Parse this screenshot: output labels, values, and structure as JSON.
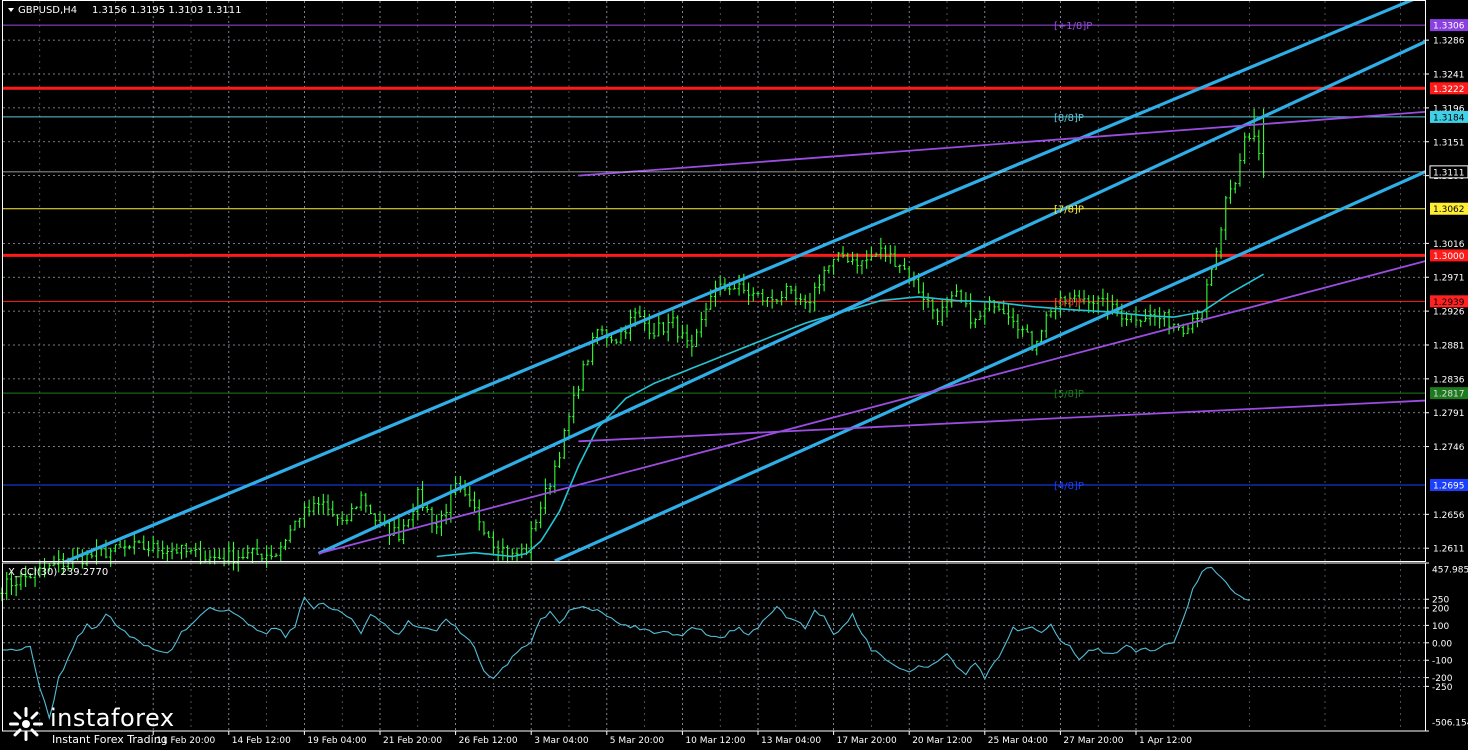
{
  "header": {
    "symbol": "GBPUSD,H4",
    "ohlc": "1.3156 1.3195 1.3103 1.3111",
    "indicator": "X_CCI(30) 239.2770"
  },
  "branding": {
    "name": "instaforex",
    "tagline": "Instant Forex Trading"
  },
  "colors": {
    "background": "#000000",
    "grid": "#9aa3b0",
    "candle": "#33ff33",
    "channel": "#2faee8",
    "ma": "#25c4d4",
    "violet": "#9b4de0",
    "red_level": "#ff1a1a",
    "cci_line": "#53bcd6",
    "axis_text": "#ffffff"
  },
  "chart_data": [
    {
      "type": "candlestick",
      "title": "GBPUSD,H4",
      "symbol": "GBPUSD",
      "timeframe": "H4",
      "ylim": [
        1.2594,
        1.3338
      ],
      "yticks": [
        1.3286,
        1.3241,
        1.3196,
        1.3151,
        1.3106,
        1.3016,
        1.2971,
        1.2926,
        1.2881,
        1.2836,
        1.2791,
        1.2746,
        1.2656,
        1.2611
      ],
      "xticks": [
        {
          "label": "11 Feb 20:00",
          "bar": 32
        },
        {
          "label": "14 Feb 12:00",
          "bar": 48
        },
        {
          "label": "19 Feb 04:00",
          "bar": 64
        },
        {
          "label": "21 Feb 20:00",
          "bar": 80
        },
        {
          "label": "26 Feb 12:00",
          "bar": 96
        },
        {
          "label": "3 Mar 04:00",
          "bar": 112
        },
        {
          "label": "5 Mar 20:00",
          "bar": 128
        },
        {
          "label": "10 Mar 12:00",
          "bar": 144
        },
        {
          "label": "13 Mar 04:00",
          "bar": 160
        },
        {
          "label": "17 Mar 20:00",
          "bar": 176
        },
        {
          "label": "20 Mar 12:00",
          "bar": 192
        },
        {
          "label": "25 Mar 04:00",
          "bar": 208
        },
        {
          "label": "27 Mar 20:00",
          "bar": 224
        },
        {
          "label": "1 Apr 12:00",
          "bar": 240
        }
      ],
      "bar_count": 270,
      "close_anchors": [
        [
          0,
          1.256
        ],
        [
          12,
          1.259
        ],
        [
          22,
          1.2606
        ],
        [
          28,
          1.2612
        ],
        [
          36,
          1.261
        ],
        [
          44,
          1.2598
        ],
        [
          52,
          1.2602
        ],
        [
          58,
          1.2604
        ],
        [
          63,
          1.2655
        ],
        [
          68,
          1.267
        ],
        [
          72,
          1.264
        ],
        [
          76,
          1.268
        ],
        [
          80,
          1.264
        ],
        [
          84,
          1.263
        ],
        [
          88,
          1.268
        ],
        [
          92,
          1.264
        ],
        [
          96,
          1.269
        ],
        [
          100,
          1.266
        ],
        [
          104,
          1.262
        ],
        [
          108,
          1.26
        ],
        [
          111,
          1.261
        ],
        [
          113,
          1.265
        ],
        [
          116,
          1.27
        ],
        [
          119,
          1.276
        ],
        [
          122,
          1.283
        ],
        [
          126,
          1.29
        ],
        [
          130,
          1.289
        ],
        [
          134,
          1.292
        ],
        [
          138,
          1.29
        ],
        [
          142,
          1.291
        ],
        [
          146,
          1.287
        ],
        [
          150,
          1.295
        ],
        [
          154,
          1.296
        ],
        [
          158,
          1.295
        ],
        [
          162,
          1.294
        ],
        [
          166,
          1.295
        ],
        [
          170,
          1.293
        ],
        [
          174,
          1.298
        ],
        [
          178,
          1.3
        ],
        [
          182,
          1.299
        ],
        [
          186,
          1.3005
        ],
        [
          190,
          1.299
        ],
        [
          194,
          1.2955
        ],
        [
          198,
          1.292
        ],
        [
          202,
          1.2945
        ],
        [
          206,
          1.291
        ],
        [
          210,
          1.294
        ],
        [
          214,
          1.292
        ],
        [
          218,
          1.288
        ],
        [
          222,
          1.293
        ],
        [
          226,
          1.294
        ],
        [
          230,
          1.2945
        ],
        [
          234,
          1.293
        ],
        [
          238,
          1.292
        ],
        [
          242,
          1.292
        ],
        [
          246,
          1.2915
        ],
        [
          250,
          1.2905
        ],
        [
          254,
          1.293
        ],
        [
          257,
          1.3
        ],
        [
          259,
          1.307
        ],
        [
          261,
          1.309
        ],
        [
          263,
          1.3156
        ],
        [
          265,
          1.316
        ],
        [
          267,
          1.3111
        ]
      ],
      "ma_anchors": [
        [
          92,
          1.26
        ],
        [
          100,
          1.2605
        ],
        [
          108,
          1.26
        ],
        [
          111,
          1.2604
        ],
        [
          114,
          1.262
        ],
        [
          118,
          1.266
        ],
        [
          122,
          1.272
        ],
        [
          126,
          1.277
        ],
        [
          132,
          1.281
        ],
        [
          138,
          1.283
        ],
        [
          146,
          1.285
        ],
        [
          154,
          1.287
        ],
        [
          162,
          1.289
        ],
        [
          170,
          1.291
        ],
        [
          178,
          1.2925
        ],
        [
          186,
          1.294
        ],
        [
          194,
          1.2945
        ],
        [
          202,
          1.294
        ],
        [
          210,
          1.2938
        ],
        [
          218,
          1.2932
        ],
        [
          226,
          1.2928
        ],
        [
          234,
          1.2925
        ],
        [
          242,
          1.292
        ],
        [
          248,
          1.2918
        ],
        [
          254,
          1.2925
        ],
        [
          260,
          1.295
        ],
        [
          267,
          1.2975
        ]
      ],
      "channel_lines": [
        {
          "name": "upper",
          "from": [
            0,
            1.2558
          ],
          "to": [
            304,
            1.3354
          ]
        },
        {
          "name": "middle",
          "from": [
            67,
            1.2604
          ],
          "to": [
            304,
            1.3292
          ]
        },
        {
          "name": "lower",
          "from": [
            117,
            1.2594
          ],
          "to": [
            304,
            1.3119
          ]
        }
      ],
      "violet_lines": [
        {
          "from": [
            122,
            1.3106
          ],
          "to": [
            304,
            1.3192
          ]
        },
        {
          "from": [
            122,
            1.2753
          ],
          "to": [
            304,
            1.2808
          ]
        },
        {
          "from": [
            67,
            1.2604
          ],
          "to": [
            304,
            1.2997
          ]
        }
      ],
      "levels": [
        {
          "value": 1.3306,
          "label": "1.3306",
          "mm": "[+1/8]P",
          "color": "#9b4de0",
          "box": "#8a3fe0",
          "boxText": "#ffffff",
          "width": 1
        },
        {
          "value": 1.3222,
          "label": "1.3222",
          "mm": "",
          "color": "#ff1a1a",
          "box": "#ff1a1a",
          "boxText": "#ffffff",
          "width": 3
        },
        {
          "value": 1.3184,
          "label": "1.3184",
          "mm": "[8/8]P",
          "color": "#5ac8dc",
          "box": "#3fd1e8",
          "boxText": "#000000",
          "width": 1
        },
        {
          "value": 1.3062,
          "label": "1.3062",
          "mm": "[7/8]P",
          "color": "#ffee33",
          "box": "#ffee33",
          "boxText": "#000000",
          "width": 1
        },
        {
          "value": 1.3,
          "label": "1.3000",
          "mm": "",
          "color": "#ff1a1a",
          "box": "#ff1a1a",
          "boxText": "#ffffff",
          "width": 3
        },
        {
          "value": 1.2939,
          "label": "1.2939",
          "mm": "[6/8]P",
          "color": "#ff2222",
          "box": "#ff2222",
          "boxText": "#000000",
          "width": 1
        },
        {
          "value": 1.2817,
          "label": "1.2817",
          "mm": "[5/8]P",
          "color": "#1e7a1e",
          "box": "#1e7a1e",
          "boxText": "#dddddd",
          "width": 1
        },
        {
          "value": 1.2695,
          "label": "1.2695",
          "mm": "[4/8]P",
          "color": "#1b3fff",
          "box": "#1b3fff",
          "boxText": "#ffffff",
          "width": 1
        }
      ],
      "current_price": {
        "value": 1.3111,
        "label": "1.3111"
      }
    },
    {
      "type": "line",
      "title": "X_CCI(30) 239.2770",
      "ylim": [
        -506.1544,
        457.9857
      ],
      "yticks": [
        457.9857,
        250,
        200,
        100,
        0,
        -100,
        -200,
        -250,
        -506.1544
      ],
      "ytick_labels": [
        "457.9857",
        "250",
        "200",
        "100",
        "0.00",
        "-100",
        "-200",
        "-250",
        "-506.1544"
      ],
      "levels": [
        250,
        200,
        100,
        0,
        -100,
        -200,
        -250
      ],
      "anchors": [
        [
          0,
          -30
        ],
        [
          4,
          -40
        ],
        [
          6,
          -20
        ],
        [
          8,
          -250
        ],
        [
          10,
          -440
        ],
        [
          12,
          -200
        ],
        [
          14,
          -90
        ],
        [
          16,
          30
        ],
        [
          18,
          100
        ],
        [
          20,
          80
        ],
        [
          22,
          170
        ],
        [
          24,
          110
        ],
        [
          26,
          60
        ],
        [
          28,
          20
        ],
        [
          30,
          -10
        ],
        [
          32,
          -30
        ],
        [
          34,
          -60
        ],
        [
          36,
          -40
        ],
        [
          38,
          60
        ],
        [
          40,
          100
        ],
        [
          42,
          160
        ],
        [
          44,
          210
        ],
        [
          46,
          180
        ],
        [
          48,
          190
        ],
        [
          50,
          150
        ],
        [
          52,
          110
        ],
        [
          54,
          80
        ],
        [
          56,
          60
        ],
        [
          58,
          90
        ],
        [
          60,
          40
        ],
        [
          62,
          100
        ],
        [
          64,
          260
        ],
        [
          66,
          200
        ],
        [
          68,
          230
        ],
        [
          70,
          190
        ],
        [
          72,
          170
        ],
        [
          74,
          140
        ],
        [
          76,
          60
        ],
        [
          78,
          160
        ],
        [
          80,
          120
        ],
        [
          82,
          80
        ],
        [
          84,
          40
        ],
        [
          86,
          120
        ],
        [
          88,
          80
        ],
        [
          90,
          90
        ],
        [
          92,
          60
        ],
        [
          94,
          140
        ],
        [
          96,
          90
        ],
        [
          98,
          40
        ],
        [
          100,
          -30
        ],
        [
          102,
          -170
        ],
        [
          104,
          -210
        ],
        [
          106,
          -150
        ],
        [
          108,
          -80
        ],
        [
          110,
          -30
        ],
        [
          112,
          10
        ],
        [
          114,
          140
        ],
        [
          116,
          170
        ],
        [
          118,
          120
        ],
        [
          120,
          180
        ],
        [
          122,
          210
        ],
        [
          124,
          190
        ],
        [
          126,
          200
        ],
        [
          128,
          150
        ],
        [
          130,
          120
        ],
        [
          132,
          100
        ],
        [
          134,
          90
        ],
        [
          136,
          80
        ],
        [
          138,
          60
        ],
        [
          140,
          70
        ],
        [
          142,
          50
        ],
        [
          144,
          40
        ],
        [
          146,
          90
        ],
        [
          148,
          70
        ],
        [
          150,
          40
        ],
        [
          152,
          20
        ],
        [
          154,
          60
        ],
        [
          156,
          80
        ],
        [
          158,
          50
        ],
        [
          160,
          80
        ],
        [
          162,
          160
        ],
        [
          164,
          200
        ],
        [
          166,
          150
        ],
        [
          168,
          130
        ],
        [
          170,
          90
        ],
        [
          172,
          180
        ],
        [
          174,
          160
        ],
        [
          176,
          40
        ],
        [
          178,
          100
        ],
        [
          180,
          160
        ],
        [
          182,
          60
        ],
        [
          184,
          -40
        ],
        [
          186,
          -60
        ],
        [
          188,
          -120
        ],
        [
          190,
          -150
        ],
        [
          192,
          -170
        ],
        [
          194,
          -130
        ],
        [
          196,
          -140
        ],
        [
          198,
          -110
        ],
        [
          200,
          -60
        ],
        [
          202,
          -140
        ],
        [
          204,
          -180
        ],
        [
          206,
          -120
        ],
        [
          208,
          -200
        ],
        [
          210,
          -120
        ],
        [
          212,
          -30
        ],
        [
          214,
          80
        ],
        [
          216,
          70
        ],
        [
          218,
          80
        ],
        [
          220,
          60
        ],
        [
          222,
          110
        ],
        [
          224,
          20
        ],
        [
          226,
          -20
        ],
        [
          228,
          -90
        ],
        [
          230,
          -50
        ],
        [
          232,
          -40
        ],
        [
          234,
          -70
        ],
        [
          236,
          -60
        ],
        [
          238,
          -20
        ],
        [
          240,
          -50
        ],
        [
          242,
          -30
        ],
        [
          244,
          -40
        ],
        [
          246,
          -20
        ],
        [
          248,
          0
        ],
        [
          250,
          150
        ],
        [
          252,
          300
        ],
        [
          254,
          400
        ],
        [
          256,
          440
        ],
        [
          258,
          380
        ],
        [
          260,
          300
        ],
        [
          262,
          260
        ],
        [
          264,
          240
        ]
      ]
    }
  ]
}
